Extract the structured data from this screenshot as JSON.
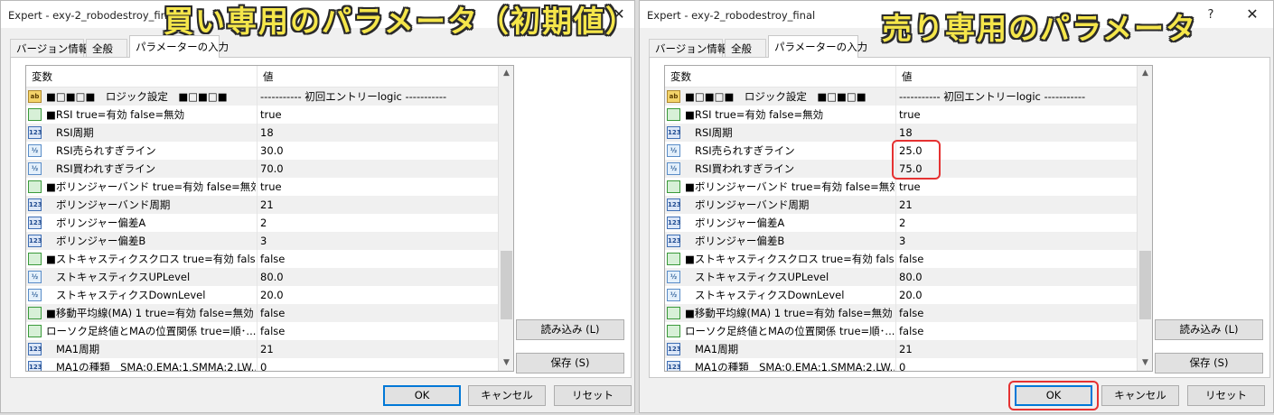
{
  "windows": [
    {
      "title": "Expert - exy-2_robodestroy_final",
      "banner": "買い専用のパラメータ（初期値）",
      "help_label": "?",
      "close_label": "✕",
      "tabs": [
        "バージョン情報",
        "全般",
        "パラメーターの入力"
      ],
      "columns": [
        "変数",
        "値"
      ],
      "rows": [
        {
          "icon": "ab",
          "name": "■□■□■　ロジック設定　■□■□■",
          "value": "----------- 初回エントリーlogic -----------"
        },
        {
          "icon": "bool",
          "name": "■RSI true=有効 false=無効",
          "value": "true"
        },
        {
          "icon": "int",
          "name": "RSI周期",
          "value": "18"
        },
        {
          "icon": "dbl",
          "name": "RSI売られすぎライン",
          "value": "30.0"
        },
        {
          "icon": "dbl",
          "name": "RSI買われすぎライン",
          "value": "70.0"
        },
        {
          "icon": "bool",
          "name": "■ボリンジャーバンド true=有効 false=無効",
          "value": "true"
        },
        {
          "icon": "int",
          "name": "ボリンジャーバンド周期",
          "value": "21"
        },
        {
          "icon": "int",
          "name": "ボリンジャー偏差A",
          "value": "2"
        },
        {
          "icon": "int",
          "name": "ボリンジャー偏差B",
          "value": "3"
        },
        {
          "icon": "bool",
          "name": "■ストキャスティクスクロス true=有効 false=無効",
          "value": "false"
        },
        {
          "icon": "dbl",
          "name": "ストキャスティクスUPLevel",
          "value": "80.0"
        },
        {
          "icon": "dbl",
          "name": "ストキャスティクスDownLevel",
          "value": "20.0"
        },
        {
          "icon": "bool",
          "name": "■移動平均線(MA) 1  true=有効 false=無効",
          "value": "false"
        },
        {
          "icon": "bool",
          "name": "ローソク足終値とMAの位置関係 true=順･...",
          "value": "false"
        },
        {
          "icon": "int",
          "name": "MA1周期",
          "value": "21"
        },
        {
          "icon": "int",
          "name": "MA1の種類　SMA:0,EMA:1,SMMA:2,LW...",
          "value": "0"
        }
      ],
      "side_buttons": [
        "読み込み (L)",
        "保存 (S)"
      ],
      "bottom_buttons": [
        "OK",
        "キャンセル",
        "リセット"
      ]
    },
    {
      "title": "Expert - exy-2_robodestroy_final",
      "banner": "売り専用のパラメータ",
      "help_label": "?",
      "close_label": "✕",
      "tabs": [
        "バージョン情報",
        "全般",
        "パラメーターの入力"
      ],
      "columns": [
        "変数",
        "値"
      ],
      "rows": [
        {
          "icon": "ab",
          "name": "■□■□■　ロジック設定　■□■□■",
          "value": "----------- 初回エントリーlogic -----------"
        },
        {
          "icon": "bool",
          "name": "■RSI true=有効 false=無効",
          "value": "true"
        },
        {
          "icon": "int",
          "name": "RSI周期",
          "value": "18"
        },
        {
          "icon": "dbl",
          "name": "RSI売られすぎライン",
          "value": "25.0"
        },
        {
          "icon": "dbl",
          "name": "RSI買われすぎライン",
          "value": "75.0"
        },
        {
          "icon": "bool",
          "name": "■ボリンジャーバンド true=有効 false=無効",
          "value": "true"
        },
        {
          "icon": "int",
          "name": "ボリンジャーバンド周期",
          "value": "21"
        },
        {
          "icon": "int",
          "name": "ボリンジャー偏差A",
          "value": "2"
        },
        {
          "icon": "int",
          "name": "ボリンジャー偏差B",
          "value": "3"
        },
        {
          "icon": "bool",
          "name": "■ストキャスティクスクロス true=有効 false=無効",
          "value": "false"
        },
        {
          "icon": "dbl",
          "name": "ストキャスティクスUPLevel",
          "value": "80.0"
        },
        {
          "icon": "dbl",
          "name": "ストキャスティクスDownLevel",
          "value": "20.0"
        },
        {
          "icon": "bool",
          "name": "■移動平均線(MA) 1  true=有効 false=無効",
          "value": "false"
        },
        {
          "icon": "bool",
          "name": "ローソク足終値とMAの位置関係 true=順･...",
          "value": "false"
        },
        {
          "icon": "int",
          "name": "MA1周期",
          "value": "21"
        },
        {
          "icon": "int",
          "name": "MA1の種類　SMA:0,EMA:1,SMMA:2,LW...",
          "value": "0"
        }
      ],
      "side_buttons": [
        "読み込み (L)",
        "保存 (S)"
      ],
      "bottom_buttons": [
        "OK",
        "キャンセル",
        "リセット"
      ]
    }
  ],
  "icon_glyphs": {
    "ab": "ab",
    "bool": "",
    "int": "123",
    "dbl": "½"
  },
  "accent_color": "#0078d7",
  "highlight_color": "#e53232",
  "banner_color": "#f5e64a"
}
